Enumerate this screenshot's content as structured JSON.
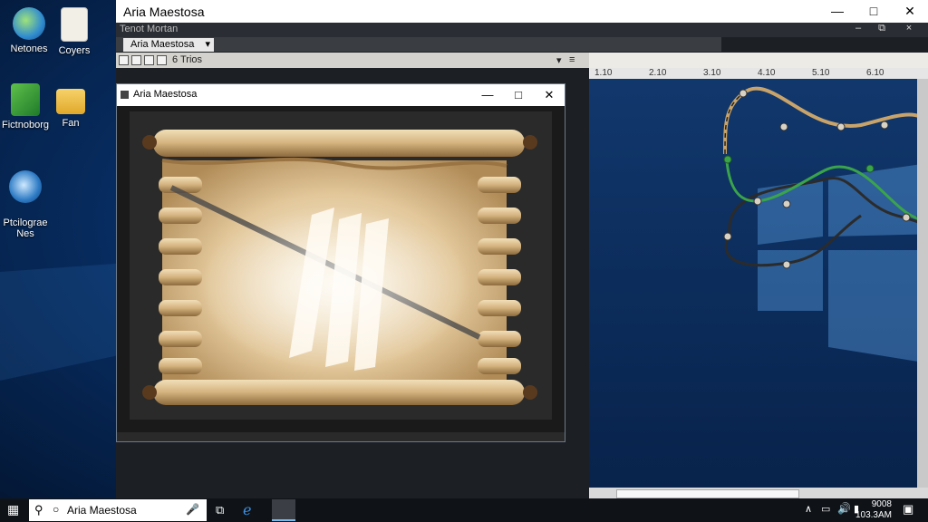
{
  "desktop": {
    "icons": [
      {
        "label": "Netones",
        "icon": "globe-icon"
      },
      {
        "label": "Coyers",
        "icon": "document-icon"
      },
      {
        "label": "Fictnoborg",
        "icon": "app-icon"
      },
      {
        "label": "Fan",
        "icon": "folder-icon"
      },
      {
        "label": "Ptcilograe\nNes",
        "icon": "globe-icon"
      }
    ]
  },
  "main_window": {
    "title": "Aria Maestosa",
    "menu_doc": "Tenot Mortan",
    "tab_label": "Aria Maestosa",
    "toolbar_label": "6 Trios",
    "ruler_ticks": [
      "1.10",
      "2.10",
      "3.10",
      "4.10",
      "5.10",
      "6.10"
    ]
  },
  "dialog": {
    "title": "Aria Maestosa"
  },
  "taskbar": {
    "search_placeholder": "Aria Maestosa",
    "time": "9008",
    "date": "103.3AM"
  },
  "colors": {
    "desktop_blue": "#0f4f9a",
    "titlebar": "#ffffff",
    "curve_green": "#3aa44a",
    "curve_dark": "#2b2b2b",
    "curve_tan": "#c9a46a"
  }
}
